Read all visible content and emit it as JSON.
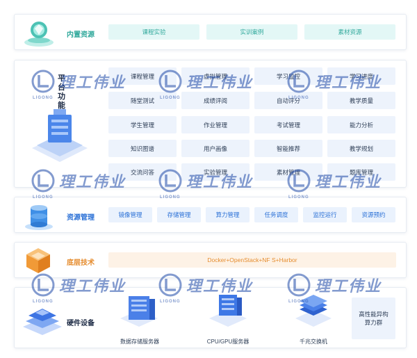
{
  "rows": {
    "builtin": {
      "label": "内置资源",
      "items": [
        "课程实验",
        "实训案例",
        "素材资源"
      ]
    },
    "platform": {
      "label": "平台功能",
      "grid": [
        [
          "课程管理",
          "虚拟管理",
          "学习监控",
          "学习进度"
        ],
        [
          "随堂测试",
          "成绩评阅",
          "自动评分",
          "教学质量"
        ],
        [
          "学生管理",
          "作业管理",
          "考试管理",
          "能力分析"
        ],
        [
          "知识图谱",
          "用户画像",
          "智能推荐",
          "教学规划"
        ],
        [
          "交流问答",
          "实验管理",
          "素材管理",
          "题库管理"
        ]
      ]
    },
    "resource": {
      "label": "资源管理",
      "items": [
        "镜像管理",
        "存储管理",
        "算力管理",
        "任务调度",
        "监控运行",
        "资源预约"
      ]
    },
    "base": {
      "label": "底层技术",
      "tech": "Docker+OpenStack+NF S+Harbor"
    },
    "hardware": {
      "label": "硬件设备",
      "devices": [
        "数据存储服务器",
        "CPU/GPU服务器",
        "千兆交换机"
      ],
      "cluster": "高性能异构算力群"
    }
  },
  "watermark": {
    "text": "理工伟业",
    "sub": "LIGONG"
  },
  "colors": {
    "teal": "#2fa89b",
    "blue": "#2a70d6",
    "orange": "#e58c2e",
    "navy": "#1d2b45"
  }
}
